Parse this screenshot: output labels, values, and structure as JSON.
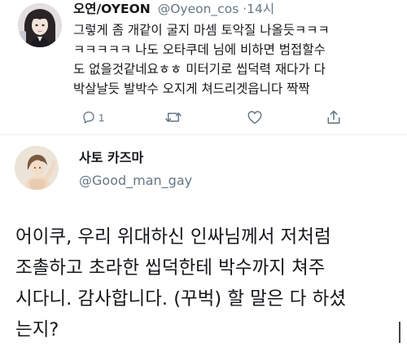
{
  "tweet1": {
    "display_name": "오연/OYEON",
    "handle": "@Oyeon_cos",
    "separator": "·",
    "time": "14시",
    "lines": [
      "그렇게 좀 개같이 굴지 마셈 토악질 나올듯ㅋㅋㅋ",
      "ㅋㅋㅋㅋㅋ 나도 오타쿠데 님에 비하면 범접할수",
      "도 없을것같네요ㅎㅎ 미터기로 씹덕력 재다가 다",
      "박살날듯 발박수 오지게 쳐드리겟읍니다 짝짝"
    ],
    "actions": {
      "reply_icon": "reply-icon",
      "reply_count": "1",
      "retweet_icon": "retweet-icon",
      "like_icon": "heart-icon",
      "share_icon": "share-icon"
    }
  },
  "tweet2": {
    "display_name": "사토 카즈마",
    "handle": "@Good_man_gay",
    "lines": [
      "어이쿠, 우리 위대하신 인싸님께서 저처럼",
      "조촐하고 초라한 씹덕한테 박수까지 쳐주",
      "시다니. 감사합니다. (꾸벅) 할 말은 다 하셨",
      "는지?"
    ]
  },
  "colors": {
    "text_primary": "#14171a",
    "text_secondary": "#657786",
    "divider": "#e6ecf0",
    "background": "#ffffff"
  }
}
